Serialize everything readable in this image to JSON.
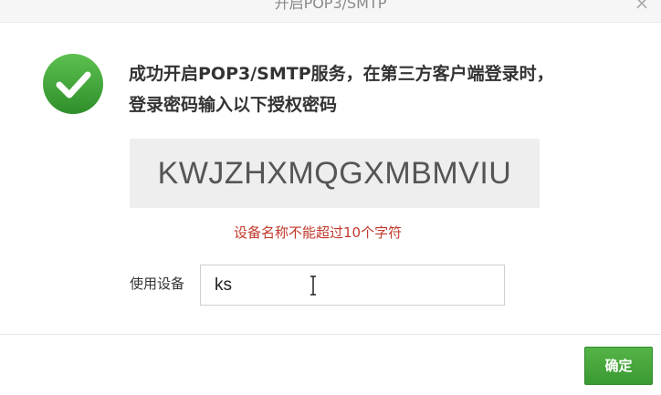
{
  "dialog": {
    "title": "开启POP3/SMTP",
    "close_symbol": "×",
    "success_icon": "check-circle-icon",
    "message": "成功开启POP3/SMTP服务，在第三方客户端登录时，登录密码输入以下授权密码",
    "authorization_code": "KWJZHXMQGXMBMVIU",
    "error_message": "设备名称不能超过10个字符",
    "device": {
      "label": "使用设备",
      "value": "ks"
    },
    "confirm_label": "确定",
    "colors": {
      "success_green": "#3fa43a",
      "error_red": "#c0392b",
      "button_green": "#46a83c",
      "code_background": "#eeeeee"
    }
  }
}
